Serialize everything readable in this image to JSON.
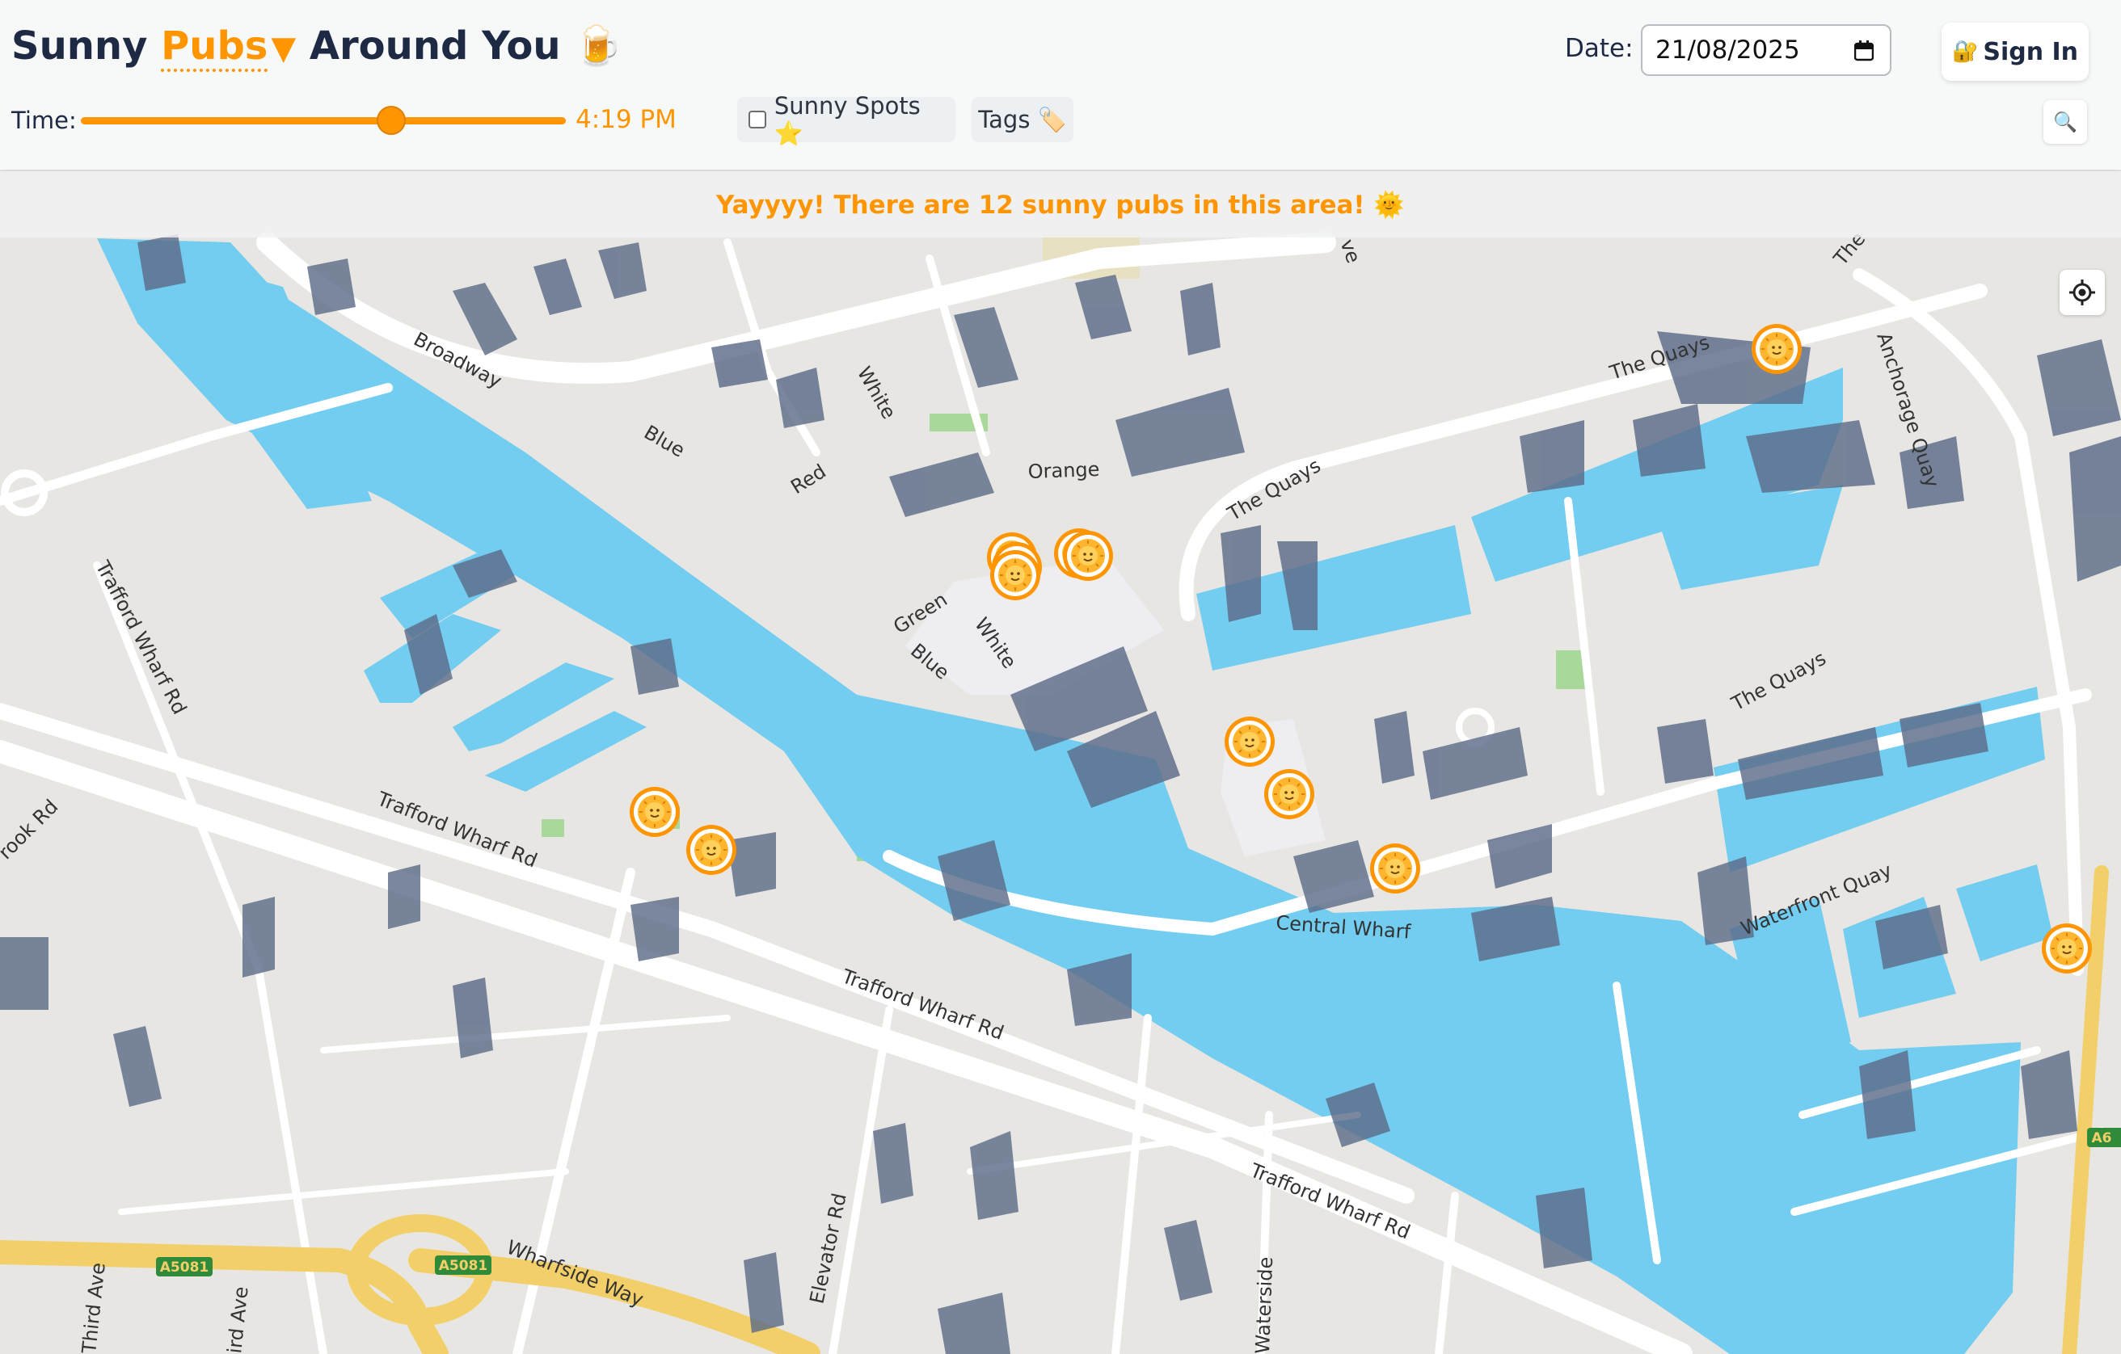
{
  "header": {
    "title_prefix": "Sunny",
    "title_pubs": "Pubs",
    "title_caret": "▼",
    "title_suffix": "Around You",
    "title_emoji": "🍺",
    "date_label": "Date:",
    "date_value": "21/08/2025",
    "signin_icon": "🔐",
    "signin_label": "Sign In",
    "time_label": "Time:",
    "time_value": "4:19 PM",
    "time_slider_fraction": 0.64,
    "sunny_spots_label": "Sunny Spots ⭐",
    "sunny_spots_checked": false,
    "tags_label": "Tags 🏷️",
    "search_icon": "🔍"
  },
  "banner": {
    "text": "Yayyyy! There are 12 sunny pubs in this area! 🌞"
  },
  "map": {
    "accent_color": "#ff9500",
    "water_color": "#72cdf0",
    "land_color": "#e8e6e3",
    "shadow_color": "#5d6c89",
    "street_labels": [
      "Broadway",
      "Blue",
      "Red",
      "White",
      "Orange",
      "Green",
      "Blue",
      "White",
      "The Quays",
      "The Quays",
      "The Quays",
      "The",
      "Anchorage Quay",
      "Trafford Wharf Rd",
      "Trafford Wharf Rd",
      "Trafford Wharf Rd",
      "Trafford Wharf Rd",
      "Central Wharf",
      "Waterfront Quay",
      "Wharfside Way",
      "Elevator Rd",
      "Waterside",
      "Third Ave",
      "ird Ave",
      "rook Rd",
      "ve",
      "A5081",
      "A5081",
      "A6"
    ],
    "marker_count": 12,
    "marker_icon": "sun-face-icon"
  }
}
